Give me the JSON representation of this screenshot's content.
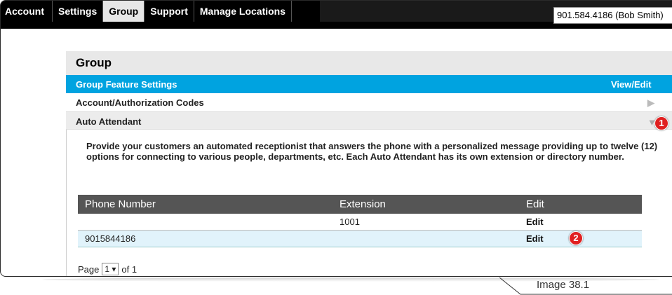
{
  "nav": {
    "tabs": [
      {
        "label": "Account"
      },
      {
        "label": "Settings"
      },
      {
        "label": "Group"
      },
      {
        "label": "Support"
      },
      {
        "label": "Manage Locations"
      }
    ],
    "active_tab": "Group",
    "user_selector_value": "901.584.4186 (Bob Smith)"
  },
  "group": {
    "title": "Group",
    "feature_settings_label": "Group Feature Settings",
    "view_edit_label": "View/Edit",
    "items": [
      {
        "label": "Account/Authorization Codes",
        "state": "collapsed"
      },
      {
        "label": "Auto Attendant",
        "state": "expanded"
      }
    ]
  },
  "auto_attendant": {
    "description": "Provide your customers an automated receptionist that answers the phone with a personalized message providing up to twelve (12) options for connecting to various people, departments, etc. Each Auto Attendant has its own extension or directory number.",
    "table": {
      "headers": [
        "Phone Number",
        "Extension",
        "Edit"
      ],
      "rows": [
        {
          "phone": "",
          "extension": "1001",
          "edit": "Edit"
        },
        {
          "phone": "9015844186",
          "extension": "",
          "edit": "Edit"
        }
      ]
    },
    "pager": {
      "prefix": "Page",
      "current": "1 ▾",
      "suffix": "of 1"
    }
  },
  "callouts": {
    "one": "1",
    "two": "2"
  },
  "caption": "Image 38.1",
  "colors": {
    "accent": "#00a3e0",
    "badge": "#e02020",
    "header_dark": "#555555"
  }
}
